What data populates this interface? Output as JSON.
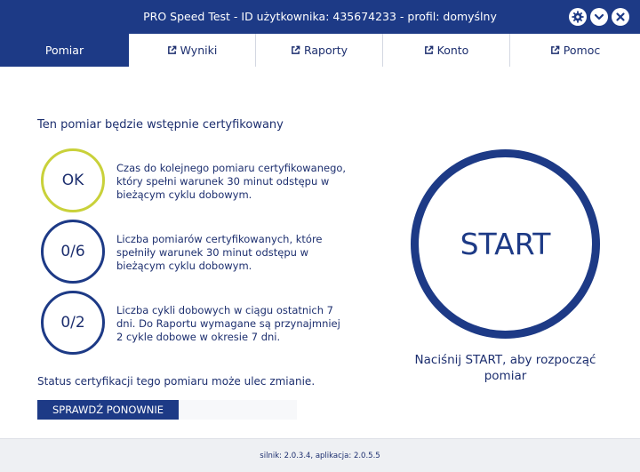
{
  "window": {
    "title": "PRO Speed Test - ID użytkownika: 435674233 - profil: domyślny",
    "buttons": [
      {
        "icon": "gear-icon"
      },
      {
        "icon": "chevron-down-icon"
      },
      {
        "icon": "close-icon"
      }
    ]
  },
  "tabs": [
    {
      "label": "Pomiar",
      "active": true,
      "icon": ""
    },
    {
      "label": "Wyniki",
      "active": false,
      "icon": "external-link-icon"
    },
    {
      "label": "Raporty",
      "active": false,
      "icon": "external-link-icon"
    },
    {
      "label": "Konto",
      "active": false,
      "icon": "external-link-icon"
    },
    {
      "label": "Pomoc",
      "active": false,
      "icon": "external-link-icon"
    }
  ],
  "main": {
    "title": "Ten pomiar będzie wstępnie certyfikowany",
    "criteria": [
      {
        "value": "OK",
        "text": "Czas do kolejnego pomiaru certyfikowanego, który spełni warunek 30 minut odstępu w bieżącym cyklu dobowym."
      },
      {
        "value": "0/6",
        "text": "Liczba pomiarów certyfikowanych, które spełniły warunek 30 minut odstępu w bieżącym cyklu dobowym."
      },
      {
        "value": "0/2",
        "text": "Liczba cykli dobowych w ciągu ostatnich 7 dni. Do Raportu wymagane są przynajmniej 2 cykle dobowe w okresie 7 dni."
      }
    ],
    "status": "Status certyfikacji tego pomiaru może ulec zmianie.",
    "recheck_label": "SPRAWDŹ PONOWNIE"
  },
  "start": {
    "label": "START",
    "hint": "Naciśnij START, aby rozpocząć pomiar"
  },
  "footer": {
    "version": "silnik: 2.0.3.4, aplikacja: 2.0.5.5"
  },
  "colors": {
    "primary": "#1d3a86",
    "ok_ring": "#c9d13a",
    "text": "#1d2f6f",
    "footer_bg": "#eef0f3"
  }
}
